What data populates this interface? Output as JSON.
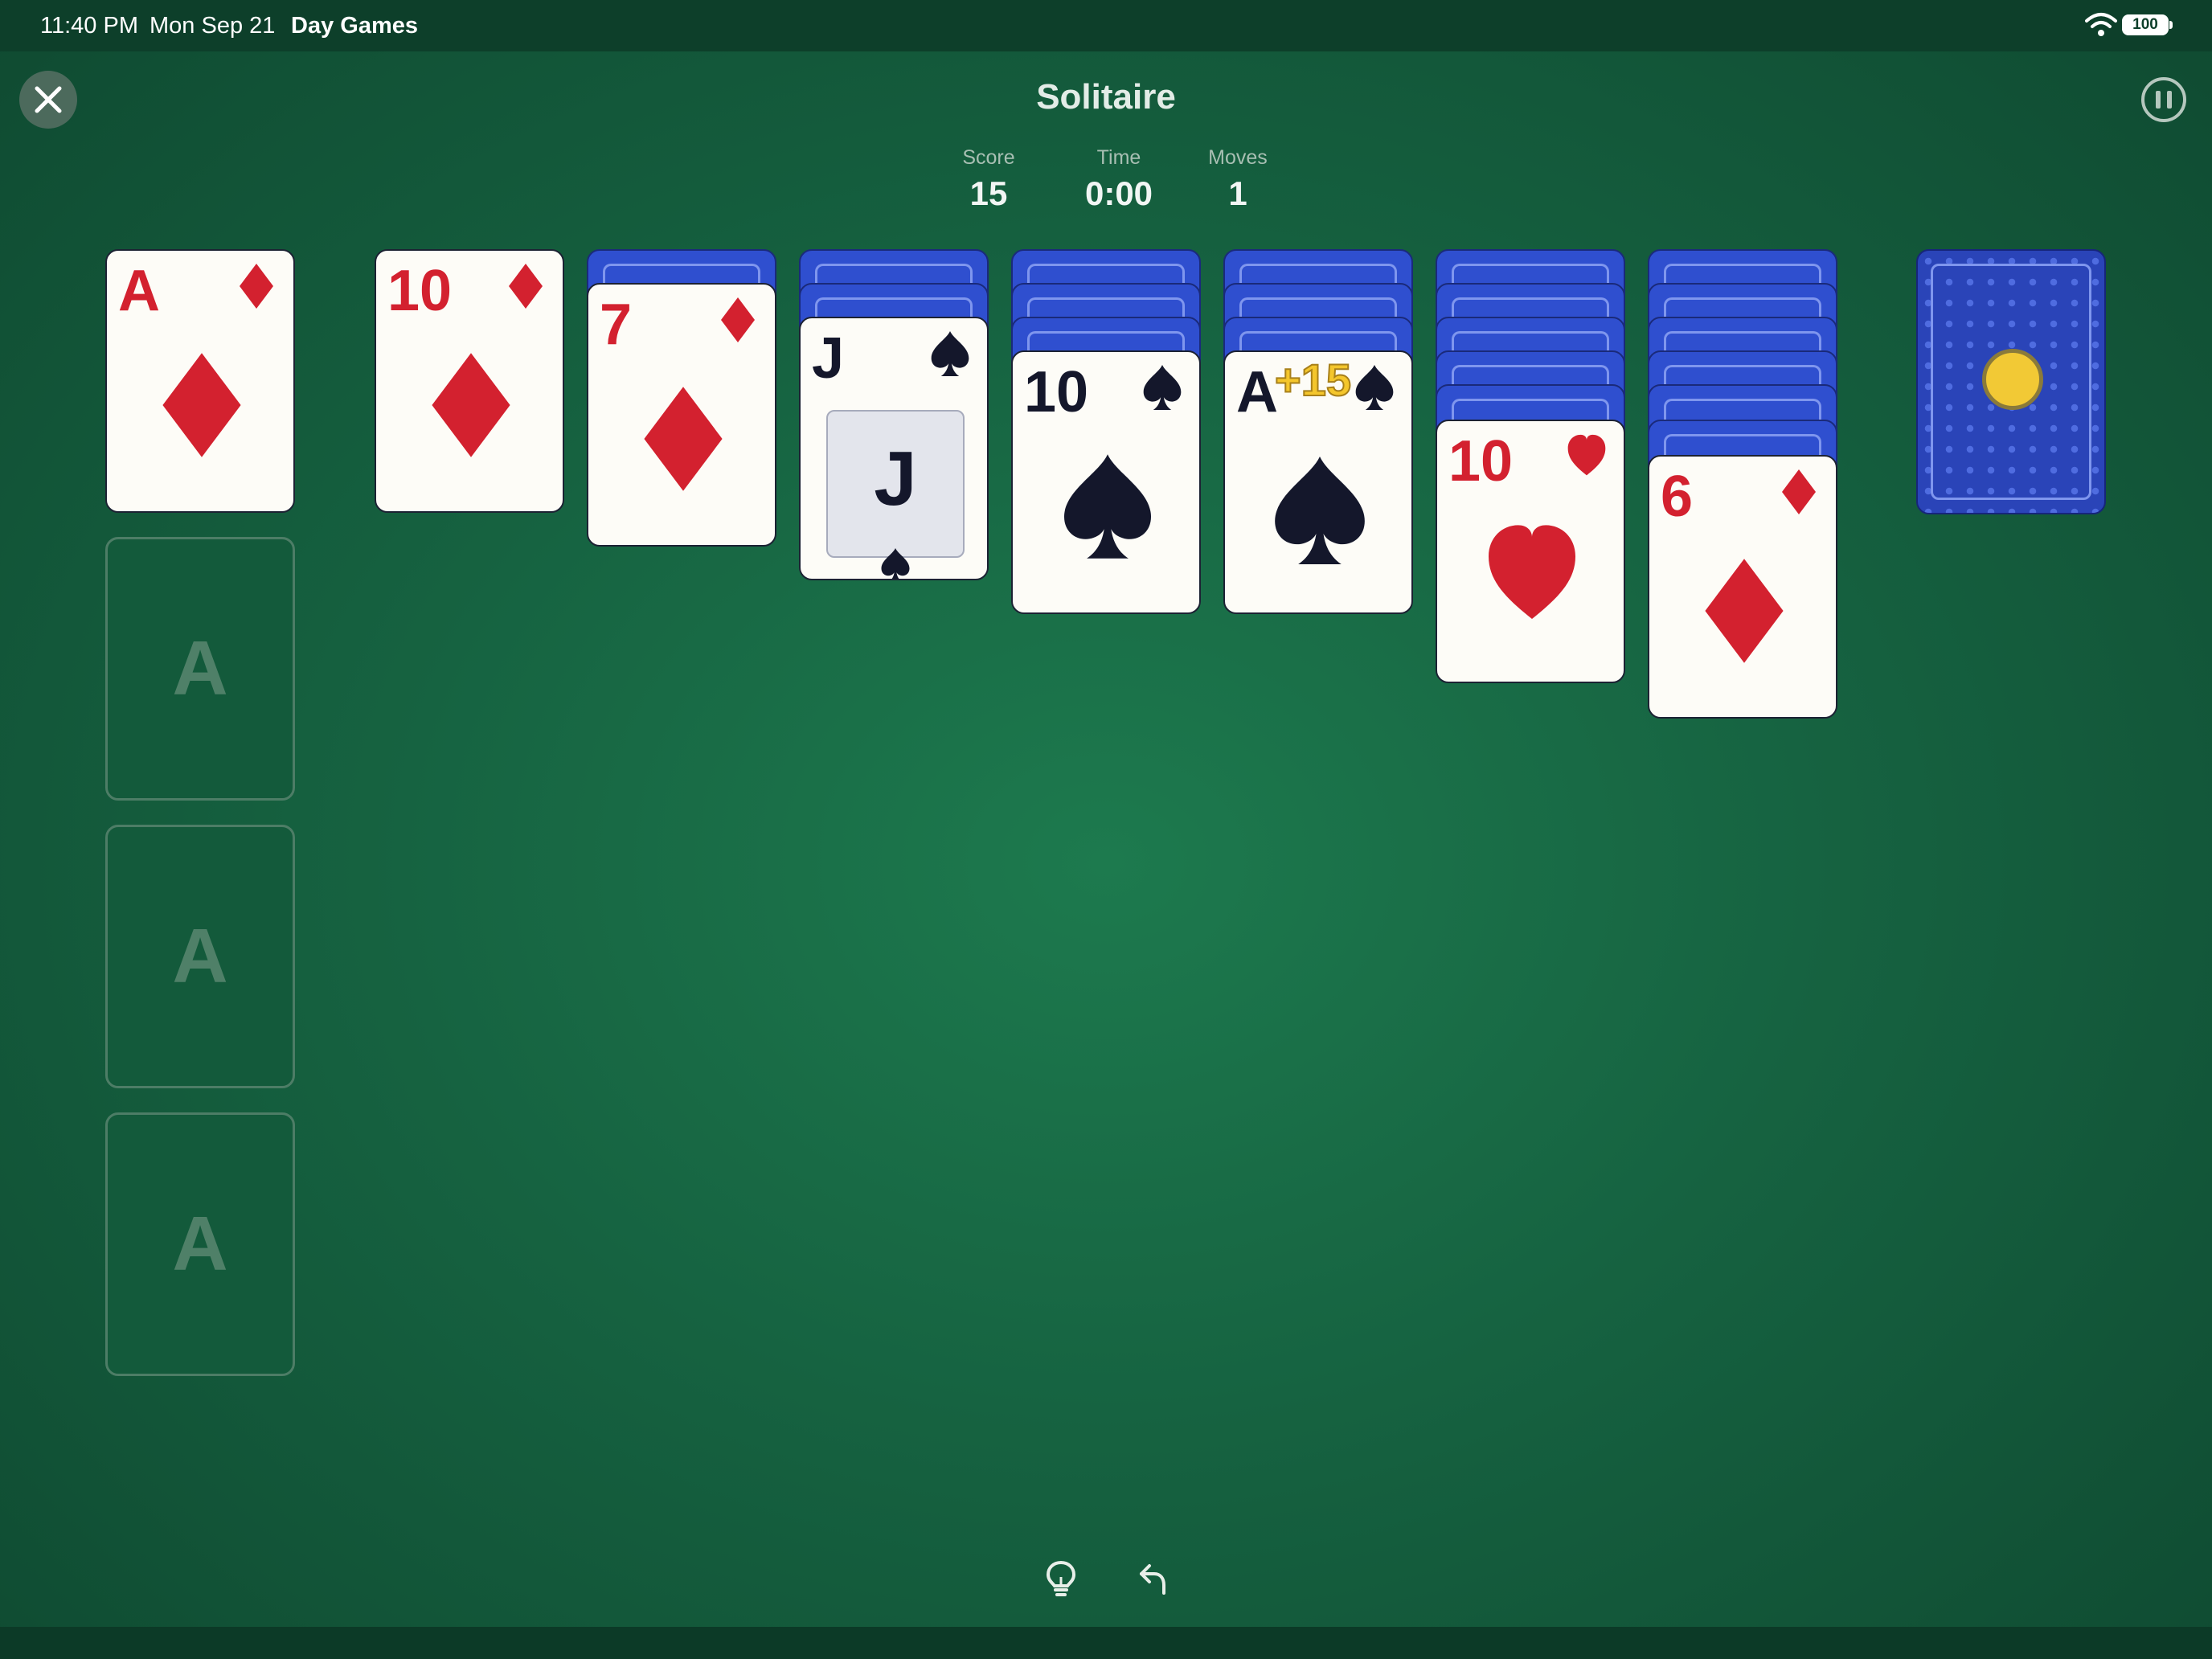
{
  "status_bar": {
    "time": "11:40 PM",
    "date": "Mon Sep 21",
    "app": "Day Games",
    "battery": "100",
    "icons": [
      "wifi-icon",
      "battery-icon"
    ]
  },
  "header": {
    "title": "Solitaire",
    "close_icon": "close-icon",
    "pause_icon": "pause-icon",
    "stats": [
      {
        "label": "Score",
        "value": "15"
      },
      {
        "label": "Time",
        "value": "0:00"
      },
      {
        "label": "Moves",
        "value": "1"
      }
    ]
  },
  "foundations": {
    "top_card": {
      "rank": "A",
      "suit": "diamonds"
    },
    "empty_placeholder": "A",
    "empty_count": 3
  },
  "waste_card": {
    "rank": "10",
    "suit": "diamonds"
  },
  "tableau": [
    {
      "face_down": 1,
      "face_up": {
        "rank": "7",
        "suit": "diamonds"
      }
    },
    {
      "face_down": 2,
      "face_up": {
        "rank": "J",
        "suit": "spades"
      }
    },
    {
      "face_down": 3,
      "face_up": {
        "rank": "10",
        "suit": "spades"
      }
    },
    {
      "face_down": 3,
      "face_up": {
        "rank": "A",
        "suit": "spades"
      }
    },
    {
      "face_down": 5,
      "face_up": {
        "rank": "10",
        "suit": "hearts"
      }
    },
    {
      "face_down": 6,
      "face_up": {
        "rank": "6",
        "suit": "diamonds"
      }
    }
  ],
  "score_popup": "+15",
  "stock": {
    "icon": "coin-icon"
  },
  "toolbar": {
    "hint_icon": "lightbulb-icon",
    "undo_icon": "undo-icon"
  },
  "colors": {
    "felt": "#1a6e47",
    "card_back": "#2f4fcf",
    "red_suit": "#d3212f",
    "black_suit": "#14172b",
    "coin": "#f2c935"
  }
}
